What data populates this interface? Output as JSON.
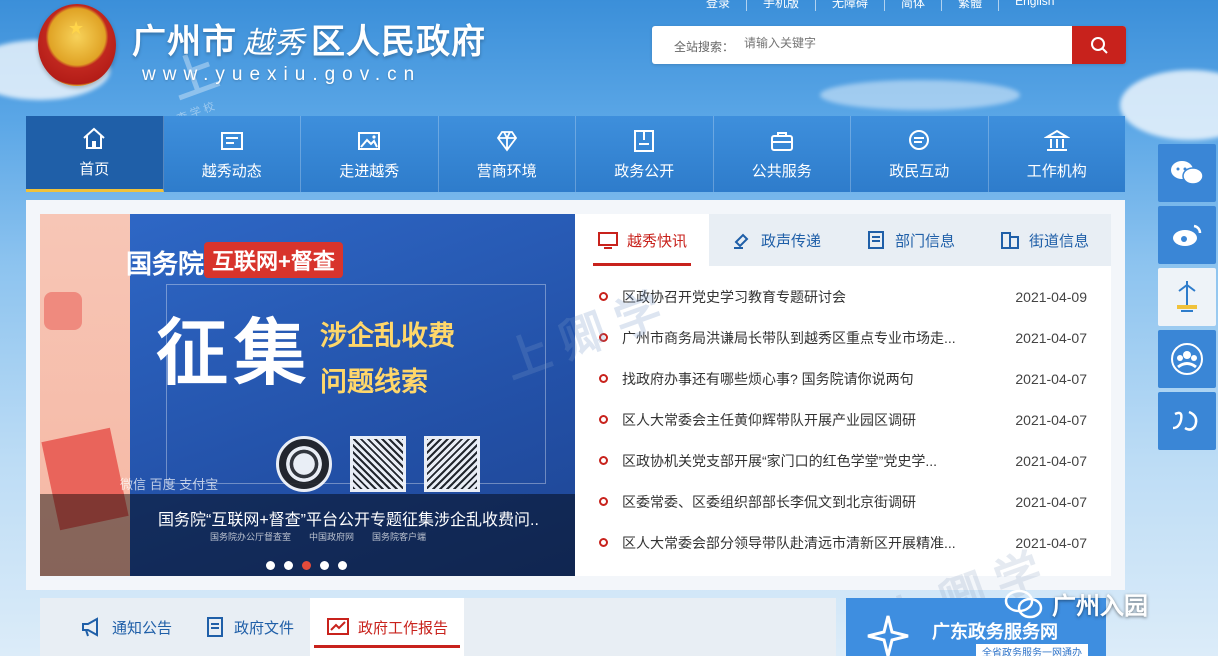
{
  "header": {
    "title_left": "广州市",
    "title_script": "越秀",
    "title_right": "区人民政府",
    "url": "www.yuexiu.gov.cn",
    "top_links": [
      "登录",
      "手机版",
      "无障碍",
      "简体",
      "繁體",
      "English"
    ],
    "search_label": "全站搜索：",
    "search_placeholder": "请输入关键字"
  },
  "nav": [
    {
      "label": "首页",
      "icon": "home-icon"
    },
    {
      "label": "越秀动态",
      "icon": "news-icon"
    },
    {
      "label": "走进越秀",
      "icon": "picture-icon"
    },
    {
      "label": "营商环境",
      "icon": "diamond-icon"
    },
    {
      "label": "政务公开",
      "icon": "book-icon"
    },
    {
      "label": "公共服务",
      "icon": "briefcase-icon"
    },
    {
      "label": "政民互动",
      "icon": "chat-icon"
    },
    {
      "label": "工作机构",
      "icon": "building-icon"
    }
  ],
  "banner": {
    "org": "国务院",
    "tag": "互联网+督查",
    "big": "征集",
    "line1": "涉企乱收费",
    "line2": "问题线索",
    "apps": "微信  百度  支付宝",
    "caption": "国务院“互联网+督查”平台公开专题征集涉企乱收费问..",
    "logo1": "国务院办公厅督查室",
    "logo2": "中国政府网",
    "logo3": "国务院客户端",
    "dots": 5,
    "active_dot": 3
  },
  "news": {
    "tabs": [
      "越秀快讯",
      "政声传递",
      "部门信息",
      "街道信息"
    ],
    "items": [
      {
        "title": "区政协召开党史学习教育专题研讨会",
        "date": "2021-04-09"
      },
      {
        "title": "广州市商务局洪谦局长带队到越秀区重点专业市场走...",
        "date": "2021-04-07"
      },
      {
        "title": "找政府办事还有哪些烦心事? 国务院请你说两句",
        "date": "2021-04-07"
      },
      {
        "title": "区人大常委会主任黄仰辉带队开展产业园区调研",
        "date": "2021-04-07"
      },
      {
        "title": "区政协机关党支部开展“家门口的红色学堂”党史学...",
        "date": "2021-04-07"
      },
      {
        "title": "区委常委、区委组织部部长李侃文到北京街调研",
        "date": "2021-04-07"
      },
      {
        "title": "区人大常委会部分领导带队赴清远市清新区开展精准...",
        "date": "2021-04-07"
      }
    ]
  },
  "bottom_tabs": [
    "通知公告",
    "政府文件",
    "政府工作报告"
  ],
  "gd": {
    "title": "广东政务服务网",
    "sub": "全省政务服务一网通办"
  },
  "watermark": {
    "wechat": "广州入园"
  }
}
